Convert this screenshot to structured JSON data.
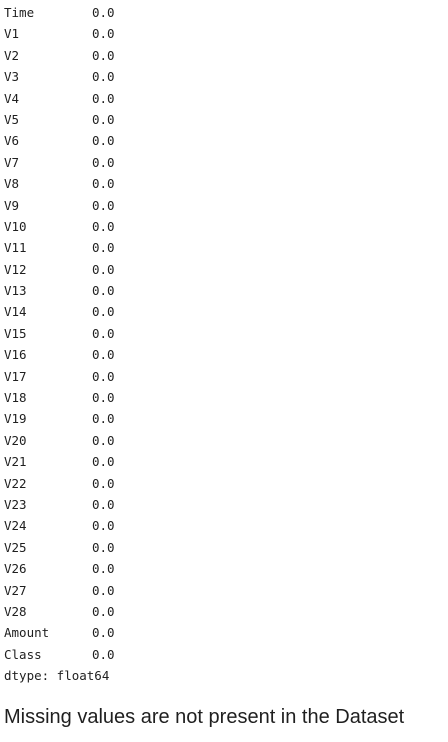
{
  "output": {
    "rows": [
      {
        "name": "Time",
        "value": "0.0"
      },
      {
        "name": "V1",
        "value": "0.0"
      },
      {
        "name": "V2",
        "value": "0.0"
      },
      {
        "name": "V3",
        "value": "0.0"
      },
      {
        "name": "V4",
        "value": "0.0"
      },
      {
        "name": "V5",
        "value": "0.0"
      },
      {
        "name": "V6",
        "value": "0.0"
      },
      {
        "name": "V7",
        "value": "0.0"
      },
      {
        "name": "V8",
        "value": "0.0"
      },
      {
        "name": "V9",
        "value": "0.0"
      },
      {
        "name": "V10",
        "value": "0.0"
      },
      {
        "name": "V11",
        "value": "0.0"
      },
      {
        "name": "V12",
        "value": "0.0"
      },
      {
        "name": "V13",
        "value": "0.0"
      },
      {
        "name": "V14",
        "value": "0.0"
      },
      {
        "name": "V15",
        "value": "0.0"
      },
      {
        "name": "V16",
        "value": "0.0"
      },
      {
        "name": "V17",
        "value": "0.0"
      },
      {
        "name": "V18",
        "value": "0.0"
      },
      {
        "name": "V19",
        "value": "0.0"
      },
      {
        "name": "V20",
        "value": "0.0"
      },
      {
        "name": "V21",
        "value": "0.0"
      },
      {
        "name": "V22",
        "value": "0.0"
      },
      {
        "name": "V23",
        "value": "0.0"
      },
      {
        "name": "V24",
        "value": "0.0"
      },
      {
        "name": "V25",
        "value": "0.0"
      },
      {
        "name": "V26",
        "value": "0.0"
      },
      {
        "name": "V27",
        "value": "0.0"
      },
      {
        "name": "V28",
        "value": "0.0"
      },
      {
        "name": "Amount",
        "value": "0.0"
      },
      {
        "name": "Class",
        "value": "0.0"
      }
    ],
    "dtype": "dtype: float64"
  },
  "markdown": {
    "heading": "Missing values are not present in the Dataset"
  }
}
